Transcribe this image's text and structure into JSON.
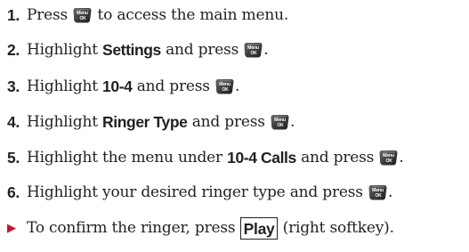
{
  "steps": [
    {
      "num": "1.",
      "parts": [
        {
          "t": "Press "
        },
        {
          "icon": true
        },
        {
          "t": " to access the main menu."
        }
      ]
    },
    {
      "num": "2.",
      "parts": [
        {
          "t": "Highlight "
        },
        {
          "b": "Settings"
        },
        {
          "t": " and press "
        },
        {
          "icon": true
        },
        {
          "t": "."
        }
      ]
    },
    {
      "num": "3.",
      "parts": [
        {
          "t": "Highlight "
        },
        {
          "b": "10-4"
        },
        {
          "t": " and press "
        },
        {
          "icon": true
        },
        {
          "t": "."
        }
      ]
    },
    {
      "num": "4.",
      "parts": [
        {
          "t": "Highlight "
        },
        {
          "b": "Ringer Type"
        },
        {
          "t": " and press "
        },
        {
          "icon": true
        },
        {
          "t": "."
        }
      ]
    },
    {
      "num": "5.",
      "parts": [
        {
          "t": "Highlight the menu under "
        },
        {
          "b": "10-4 Calls"
        },
        {
          "t": " and press "
        },
        {
          "icon": true
        },
        {
          "t": "."
        }
      ]
    },
    {
      "num": "6.",
      "parts": [
        {
          "t": "Highlight your desired ringer type and press "
        },
        {
          "icon": true
        },
        {
          "t": "."
        }
      ]
    }
  ],
  "note": {
    "bullet_icon": "red-triangle-arrow-icon",
    "text_before": "To confirm the ringer, press ",
    "softkey_label": "Play",
    "text_after": " (right softkey)."
  },
  "menu_ok_key": {
    "icon": "menu-ok-key-icon",
    "top_label": "Menu",
    "bottom_label": "OK"
  },
  "colors": {
    "text": "#231f20",
    "bullet": "#c8102e",
    "key_fill": "#3a3a3a"
  }
}
